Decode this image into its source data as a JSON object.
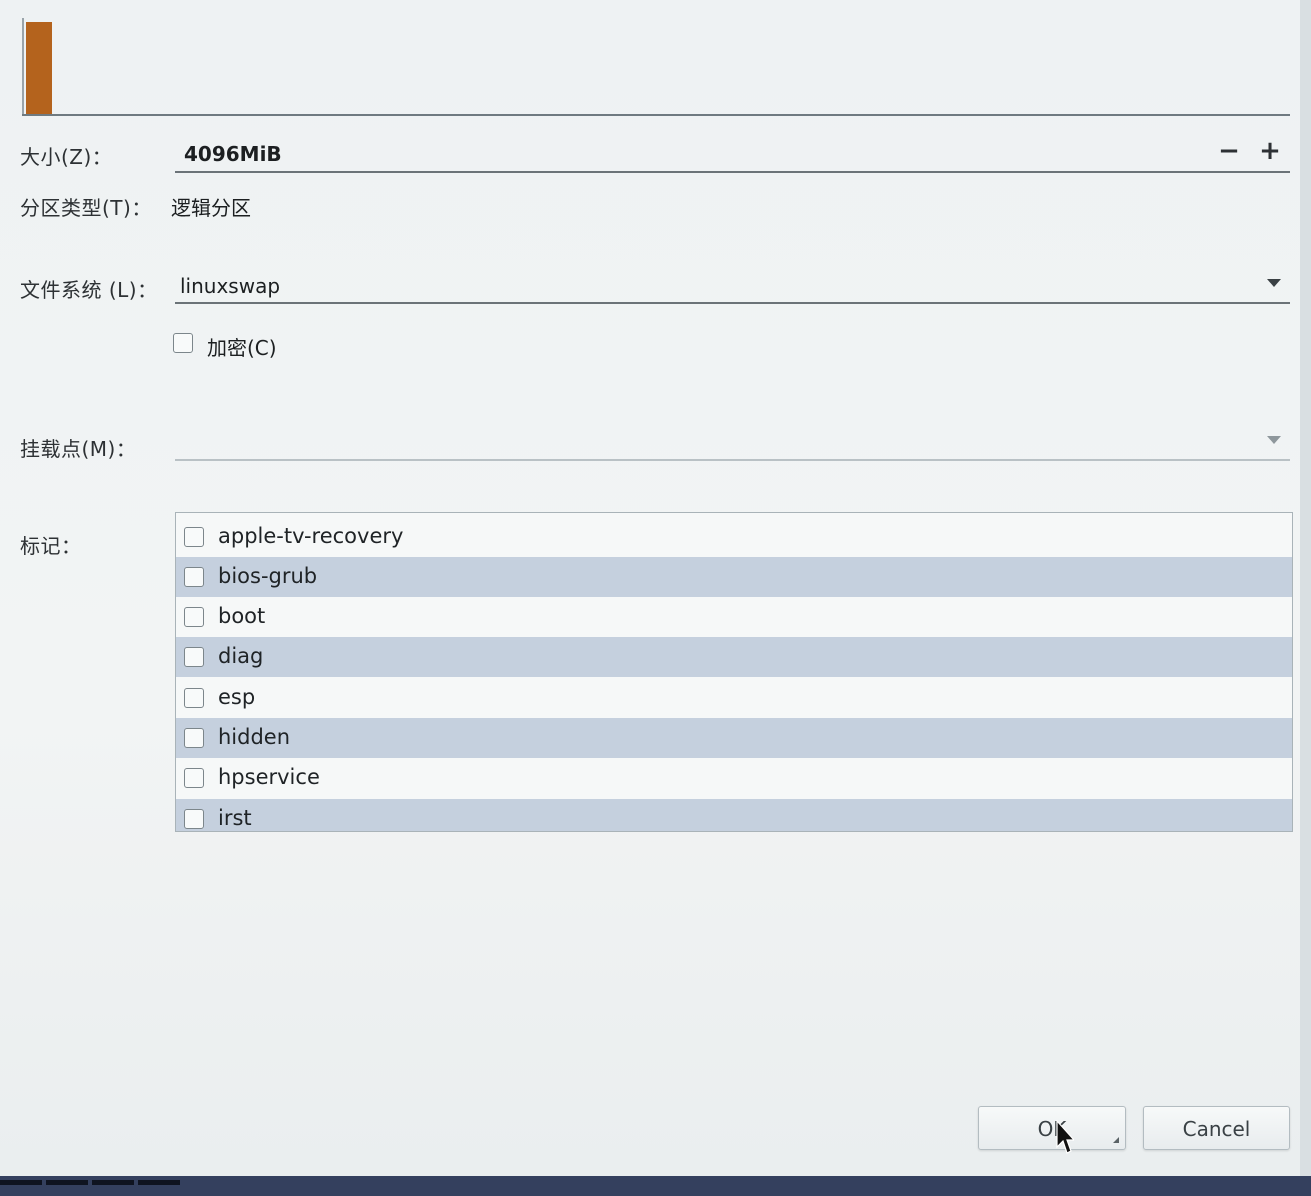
{
  "size": {
    "label": "大小(Z)：",
    "value": "4096MiB",
    "decrement": "−",
    "increment": "+"
  },
  "partition_type": {
    "label": "分区类型(T)：",
    "value": "逻辑分区"
  },
  "filesystem": {
    "label": "文件系统 (L)：",
    "value": "linuxswap"
  },
  "encrypt": {
    "label": "加密(C)",
    "checked": false
  },
  "mount_point": {
    "label": "挂载点(M)：",
    "value": ""
  },
  "flags": {
    "label": "标记：",
    "items": [
      {
        "label": "apple-tv-recovery",
        "checked": false
      },
      {
        "label": "bios-grub",
        "checked": false
      },
      {
        "label": "boot",
        "checked": false
      },
      {
        "label": "diag",
        "checked": false
      },
      {
        "label": "esp",
        "checked": false
      },
      {
        "label": "hidden",
        "checked": false
      },
      {
        "label": "hpservice",
        "checked": false
      },
      {
        "label": "irst",
        "checked": false
      }
    ]
  },
  "buttons": {
    "ok": "OK",
    "cancel": "Cancel"
  },
  "colors": {
    "used_segment": "#b4631d",
    "row_highlight": "#c5d0de"
  }
}
